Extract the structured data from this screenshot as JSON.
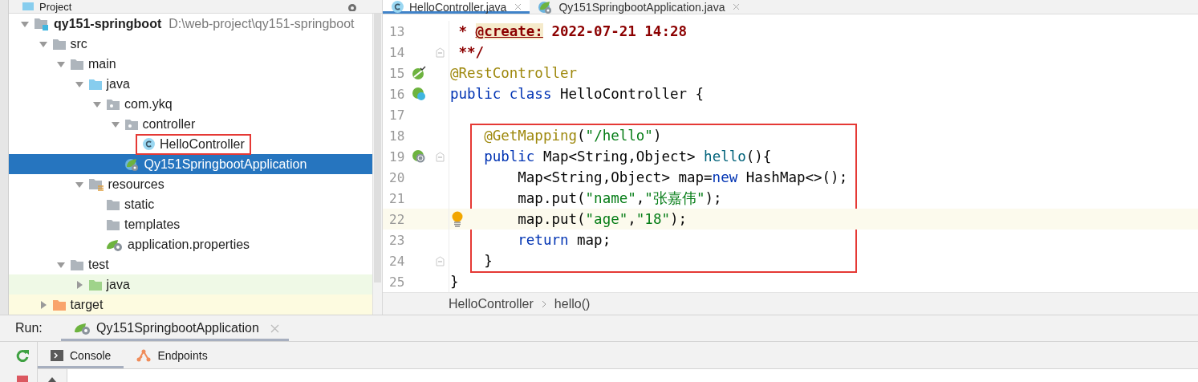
{
  "project_panel": {
    "title": "Project",
    "tree": [
      {
        "label": "qy151-springboot",
        "hint": "D:\\web-project\\qy151-springboot",
        "kind": "module",
        "expanded": true,
        "selected": false,
        "children": [
          {
            "label": "src",
            "kind": "folder",
            "expanded": true,
            "selected": false,
            "children": [
              {
                "label": "main",
                "kind": "folder",
                "expanded": true,
                "selected": false,
                "children": [
                  {
                    "label": "java",
                    "kind": "source",
                    "expanded": true,
                    "selected": false,
                    "children": [
                      {
                        "label": "com.ykq",
                        "kind": "package",
                        "expanded": true,
                        "selected": false,
                        "children": [
                          {
                            "label": "controller",
                            "kind": "package",
                            "expanded": true,
                            "selected": false,
                            "children": [
                              {
                                "label": "HelloController",
                                "kind": "class",
                                "selected": false,
                                "boxed": true
                              }
                            ]
                          },
                          {
                            "label": "Qy151SpringbootApplication",
                            "kind": "spring-app",
                            "selected": true
                          }
                        ]
                      }
                    ]
                  },
                  {
                    "label": "resources",
                    "kind": "resources",
                    "expanded": true,
                    "selected": false,
                    "children": [
                      {
                        "label": "static",
                        "kind": "folder",
                        "selected": false
                      },
                      {
                        "label": "templates",
                        "kind": "folder",
                        "selected": false
                      },
                      {
                        "label": "application.properties",
                        "kind": "properties",
                        "selected": false
                      }
                    ]
                  }
                ]
              },
              {
                "label": "test",
                "kind": "folder",
                "expanded": true,
                "selected": false,
                "children": [
                  {
                    "label": "java",
                    "kind": "test-source",
                    "expanded": false,
                    "selected": false
                  }
                ]
              }
            ]
          },
          {
            "label": "target",
            "kind": "excluded",
            "expanded": false,
            "selected": false
          }
        ]
      }
    ]
  },
  "editor": {
    "tabs": [
      {
        "label": "HelloController.java",
        "kind": "class",
        "selected": true
      },
      {
        "label": "Qy151SpringbootApplication.java",
        "kind": "spring-app",
        "selected": false
      }
    ],
    "sections": [
      {
        "boxed": false,
        "lines": [
          {
            "number": "13",
            "kind": "plain",
            "tokens": [
              {
                "text": " * ",
                "kind": "doc"
              },
              {
                "text": "@create:",
                "kind": "doctag"
              },
              {
                "text": " 2022-07-21 14:28",
                "kind": "doc"
              }
            ]
          },
          {
            "number": "14",
            "kind": "plain",
            "fold": true,
            "tokens": [
              {
                "text": " **/",
                "kind": "doc"
              }
            ]
          },
          {
            "number": "15",
            "kind": "bean",
            "tokens": [
              {
                "text": "@RestController",
                "kind": "annotation"
              }
            ]
          },
          {
            "number": "16",
            "kind": "class-bean",
            "tokens": [
              {
                "text": "public class ",
                "kind": "keyword"
              },
              {
                "text": "HelloController {",
                "kind": "plain"
              }
            ]
          },
          {
            "number": "17",
            "kind": "plain"
          }
        ]
      },
      {
        "boxed": true,
        "lines": [
          {
            "number": "18",
            "kind": "plain",
            "tokens": [
              {
                "text": "    @GetMapping",
                "kind": "annotation"
              },
              {
                "text": "(",
                "kind": "plain"
              },
              {
                "text": "\"/hello\"",
                "kind": "string"
              },
              {
                "text": ")",
                "kind": "plain"
              }
            ]
          },
          {
            "number": "19",
            "kind": "web",
            "fold": true,
            "tokens": [
              {
                "text": "    public ",
                "kind": "keyword"
              },
              {
                "text": "Map<String,Object> ",
                "kind": "plain"
              },
              {
                "text": "hello",
                "kind": "method"
              },
              {
                "text": "(){",
                "kind": "plain"
              }
            ]
          },
          {
            "number": "20",
            "kind": "plain",
            "tokens": [
              {
                "text": "        Map<String,Object> map=",
                "kind": "plain"
              },
              {
                "text": "new ",
                "kind": "keyword"
              },
              {
                "text": "HashMap<>();",
                "kind": "plain"
              }
            ]
          },
          {
            "number": "21",
            "kind": "plain",
            "tokens": [
              {
                "text": "        map.put(",
                "kind": "plain"
              },
              {
                "text": "\"name\"",
                "kind": "string"
              },
              {
                "text": ",",
                "kind": "plain"
              },
              {
                "text": "\"张嘉伟\"",
                "kind": "string"
              },
              {
                "text": ");",
                "kind": "plain"
              }
            ]
          },
          {
            "number": "22",
            "kind": "plain",
            "current": true,
            "bulb": true,
            "tokens": [
              {
                "text": "        map.put(",
                "kind": "plain"
              },
              {
                "text": "\"age\"",
                "kind": "string"
              },
              {
                "text": ",",
                "kind": "plain"
              },
              {
                "text": "\"18\"",
                "kind": "string"
              },
              {
                "text": ");",
                "kind": "plain"
              }
            ]
          },
          {
            "number": "23",
            "kind": "plain",
            "tokens": [
              {
                "text": "        return ",
                "kind": "keyword"
              },
              {
                "text": "map;",
                "kind": "plain"
              }
            ]
          },
          {
            "number": "24",
            "kind": "plain",
            "fold": true,
            "tokens": [
              {
                "text": "    }",
                "kind": "plain"
              }
            ]
          }
        ]
      },
      {
        "boxed": false,
        "lines": [
          {
            "number": "25",
            "kind": "plain",
            "tokens": [
              {
                "text": "}",
                "kind": "plain"
              }
            ]
          }
        ]
      }
    ],
    "breadcrumbs": [
      "HelloController",
      "hello()"
    ]
  },
  "run_panel": {
    "label": "Run:",
    "config_tab": "Qy151SpringbootApplication",
    "tabs": [
      {
        "label": "Console",
        "kind": "console",
        "selected": true
      },
      {
        "label": "Endpoints",
        "kind": "endpoints",
        "selected": false
      }
    ]
  }
}
